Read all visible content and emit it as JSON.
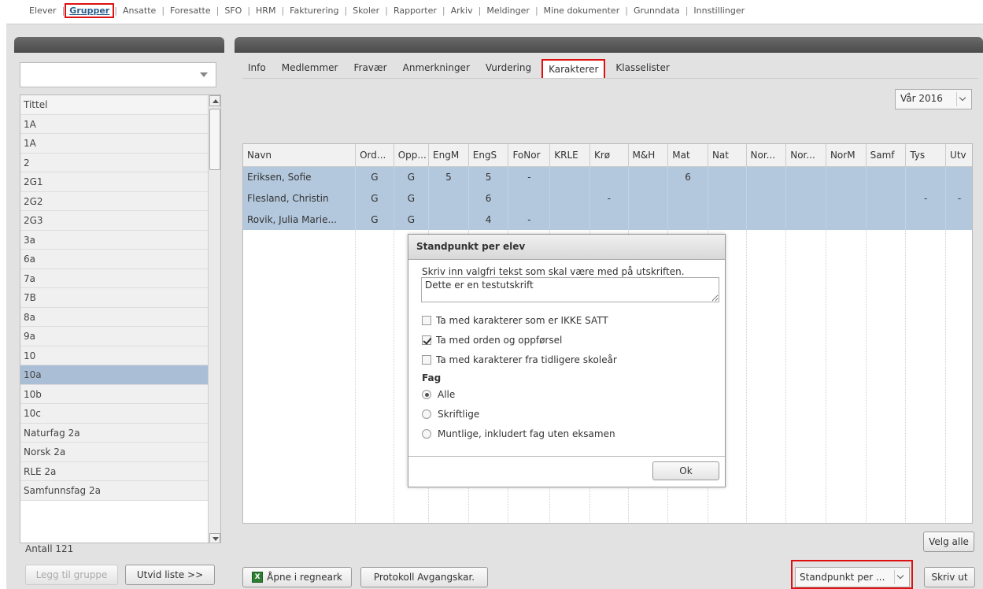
{
  "topmenu": {
    "items": [
      "Elever",
      "Grupper",
      "Ansatte",
      "Foresatte",
      "SFO",
      "HRM",
      "Fakturering",
      "Skoler",
      "Rapporter",
      "Arkiv",
      "Meldinger",
      "Mine dokumenter",
      "Grunndata",
      "Innstillinger"
    ],
    "active": "Grupper"
  },
  "left": {
    "list_header": "Tittel",
    "groups": [
      "1A",
      "1A",
      "2",
      "2G1",
      "2G2",
      "2G3",
      "3a",
      "6a",
      "7a",
      "7B",
      "8a",
      "9a",
      "10",
      "10a",
      "10b",
      "10c",
      "Naturfag 2a",
      "Norsk 2a",
      "RLE 2a",
      "Samfunnsfag 2a"
    ],
    "selected_group": "10a",
    "count_label": "Antall 121",
    "add_group_button": "Legg til gruppe",
    "expand_list_button": "Utvid liste >>"
  },
  "right": {
    "tabs": [
      "Info",
      "Medlemmer",
      "Fravær",
      "Anmerkninger",
      "Vurdering",
      "Karakterer",
      "Klasselister"
    ],
    "active_tab": "Karakterer",
    "period": "Vår 2016",
    "columns": [
      "Navn",
      "Ord...",
      "Opp...",
      "EngM",
      "EngS",
      "FoNor",
      "KRLE",
      "Krø",
      "M&H",
      "Mat",
      "Nat",
      "Nor...",
      "Nor...",
      "NorM",
      "Samf",
      "Tys",
      "Utv"
    ],
    "rows": [
      [
        "Eriksen, Sofie",
        "G",
        "G",
        "5",
        "5",
        "-",
        "",
        "",
        "",
        "6",
        "",
        "",
        "",
        "",
        "",
        "",
        ""
      ],
      [
        "Flesland, Christin",
        "G",
        "G",
        "",
        "6",
        "",
        "",
        "-",
        "",
        "",
        "",
        "",
        "",
        "",
        "",
        "-",
        "-"
      ],
      [
        "Rovik, Julia Marie...",
        "G",
        "G",
        "",
        "4",
        "-",
        "",
        "",
        "",
        "",
        "",
        "",
        "",
        "",
        "",
        "",
        ""
      ]
    ],
    "select_all_button": "Velg alle",
    "open_spreadsheet_button": "Åpne i regneark",
    "protocol_button": "Protokoll Avgangskar.",
    "report_select_value": "Standpunkt per ...",
    "print_button": "Skriv ut"
  },
  "dialog": {
    "title": "Standpunkt per elev",
    "prompt": "Skriv inn valgfri tekst som skal være med på utskriften.",
    "text_value": "Dette er en testutskrift",
    "checkboxes": [
      {
        "label": "Ta med karakterer som er IKKE SATT",
        "checked": false
      },
      {
        "label": "Ta med orden og oppførsel",
        "checked": true
      },
      {
        "label": "Ta med karakterer fra tidligere skoleår",
        "checked": false
      }
    ],
    "fag_label": "Fag",
    "radios": [
      {
        "label": "Alle",
        "checked": true
      },
      {
        "label": "Skriftlige",
        "checked": false
      },
      {
        "label": "Muntlige, inkludert fag uten eksamen",
        "checked": false
      }
    ],
    "ok_button": "Ok"
  },
  "colors": {
    "selection": "#b3c7dd",
    "highlight_red": "#d11111",
    "panel_header": "#555555"
  }
}
